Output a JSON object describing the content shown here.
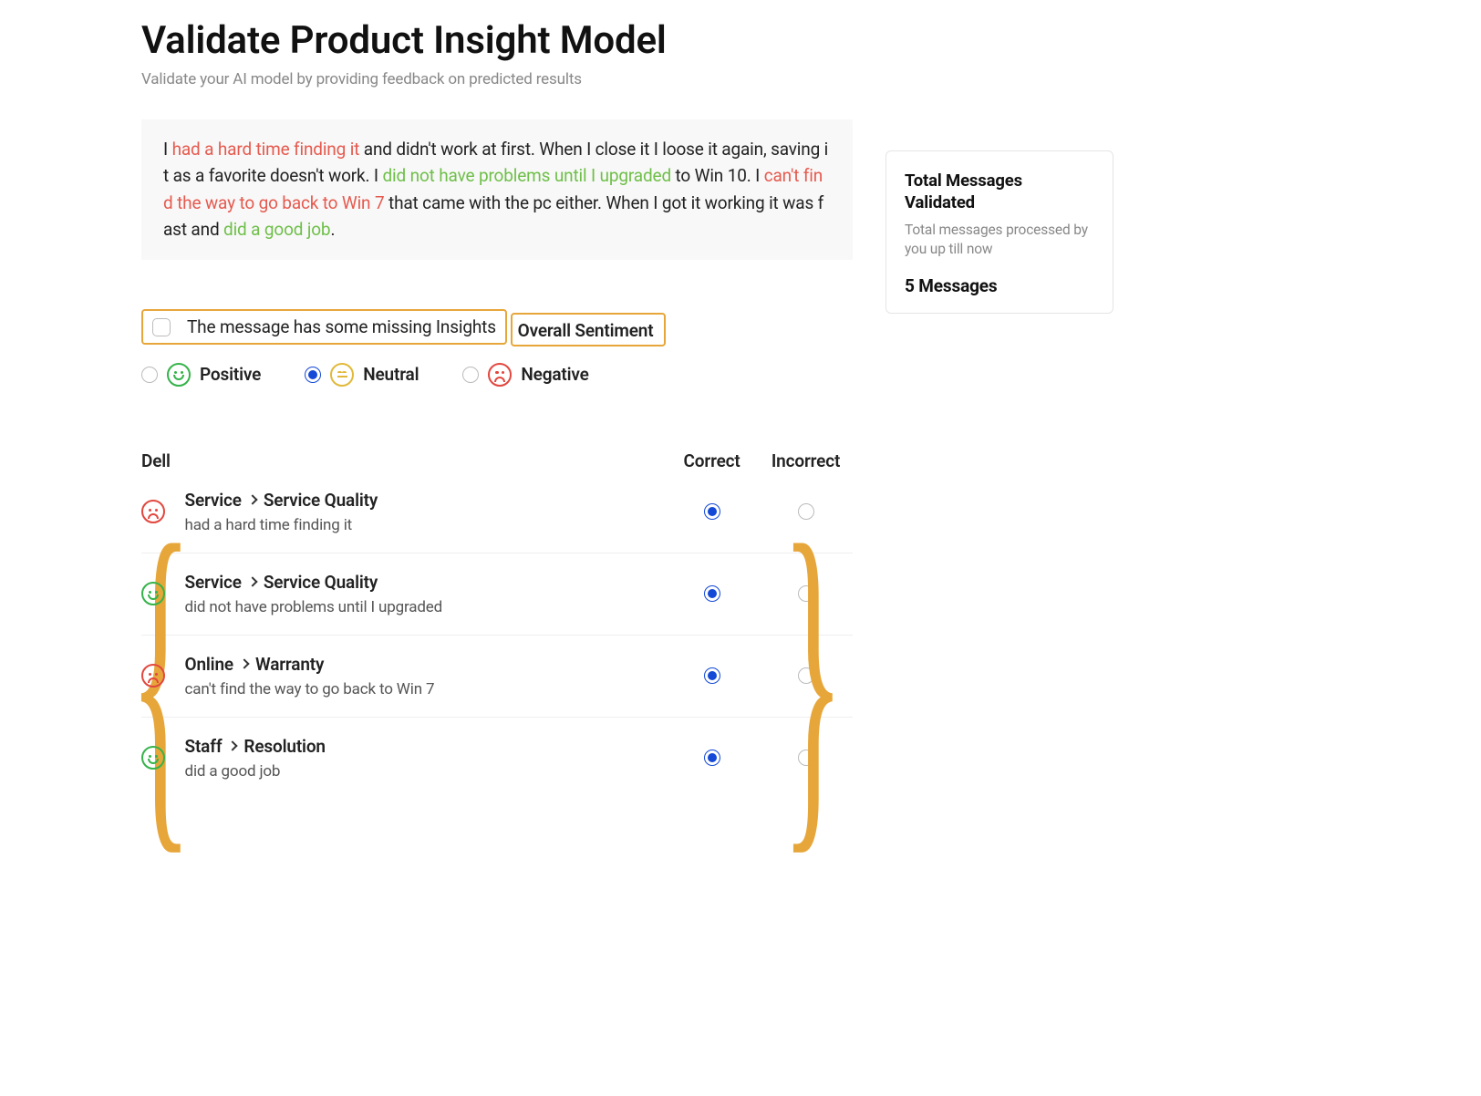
{
  "title": "Validate Product Insight Model",
  "subtitle": "Validate your AI model by providing feedback on predicted results",
  "message": {
    "segments": [
      {
        "text": "I ",
        "cls": ""
      },
      {
        "text": "had a hard time finding it",
        "cls": "hl-neg"
      },
      {
        "text": " and didn't work at first. When I close it I loose it again, saving it as a favorite doesn't work. I ",
        "cls": ""
      },
      {
        "text": "did not have problems until I upgraded",
        "cls": "hl-pos"
      },
      {
        "text": " to Win 10. I ",
        "cls": ""
      },
      {
        "text": "can't find the way to go back to Win 7",
        "cls": "hl-neg"
      },
      {
        "text": " that came with the pc either. When I got it working it was fast and ",
        "cls": ""
      },
      {
        "text": "did a good job",
        "cls": "hl-pos"
      },
      {
        "text": ".",
        "cls": ""
      }
    ]
  },
  "missing_label": "The message has some missing Insights",
  "sentiment": {
    "heading": "Overall Sentiment",
    "options": [
      {
        "label": "Positive",
        "face": "pos",
        "checked": false
      },
      {
        "label": "Neutral",
        "face": "neu",
        "checked": true
      },
      {
        "label": "Negative",
        "face": "neg",
        "checked": false
      }
    ]
  },
  "topics": {
    "subject": "Dell",
    "head_correct": "Correct",
    "head_incorrect": "Incorrect",
    "rows": [
      {
        "face": "neg",
        "path": [
          "Service",
          "Service Quality"
        ],
        "snippet": "had a hard time finding it",
        "correct": true
      },
      {
        "face": "pos",
        "path": [
          "Service",
          "Service Quality"
        ],
        "snippet": "did not have problems until I upgraded",
        "correct": true
      },
      {
        "face": "neg",
        "path": [
          "Online",
          "Warranty"
        ],
        "snippet": "can't find the way to go back to Win 7",
        "correct": true
      },
      {
        "face": "pos",
        "path": [
          "Staff",
          "Resolution"
        ],
        "snippet": "did a good job",
        "correct": true
      }
    ]
  },
  "side": {
    "title": "Total Messages Validated",
    "sub": "Total messages processed by you up till now",
    "value": "5 Messages"
  }
}
